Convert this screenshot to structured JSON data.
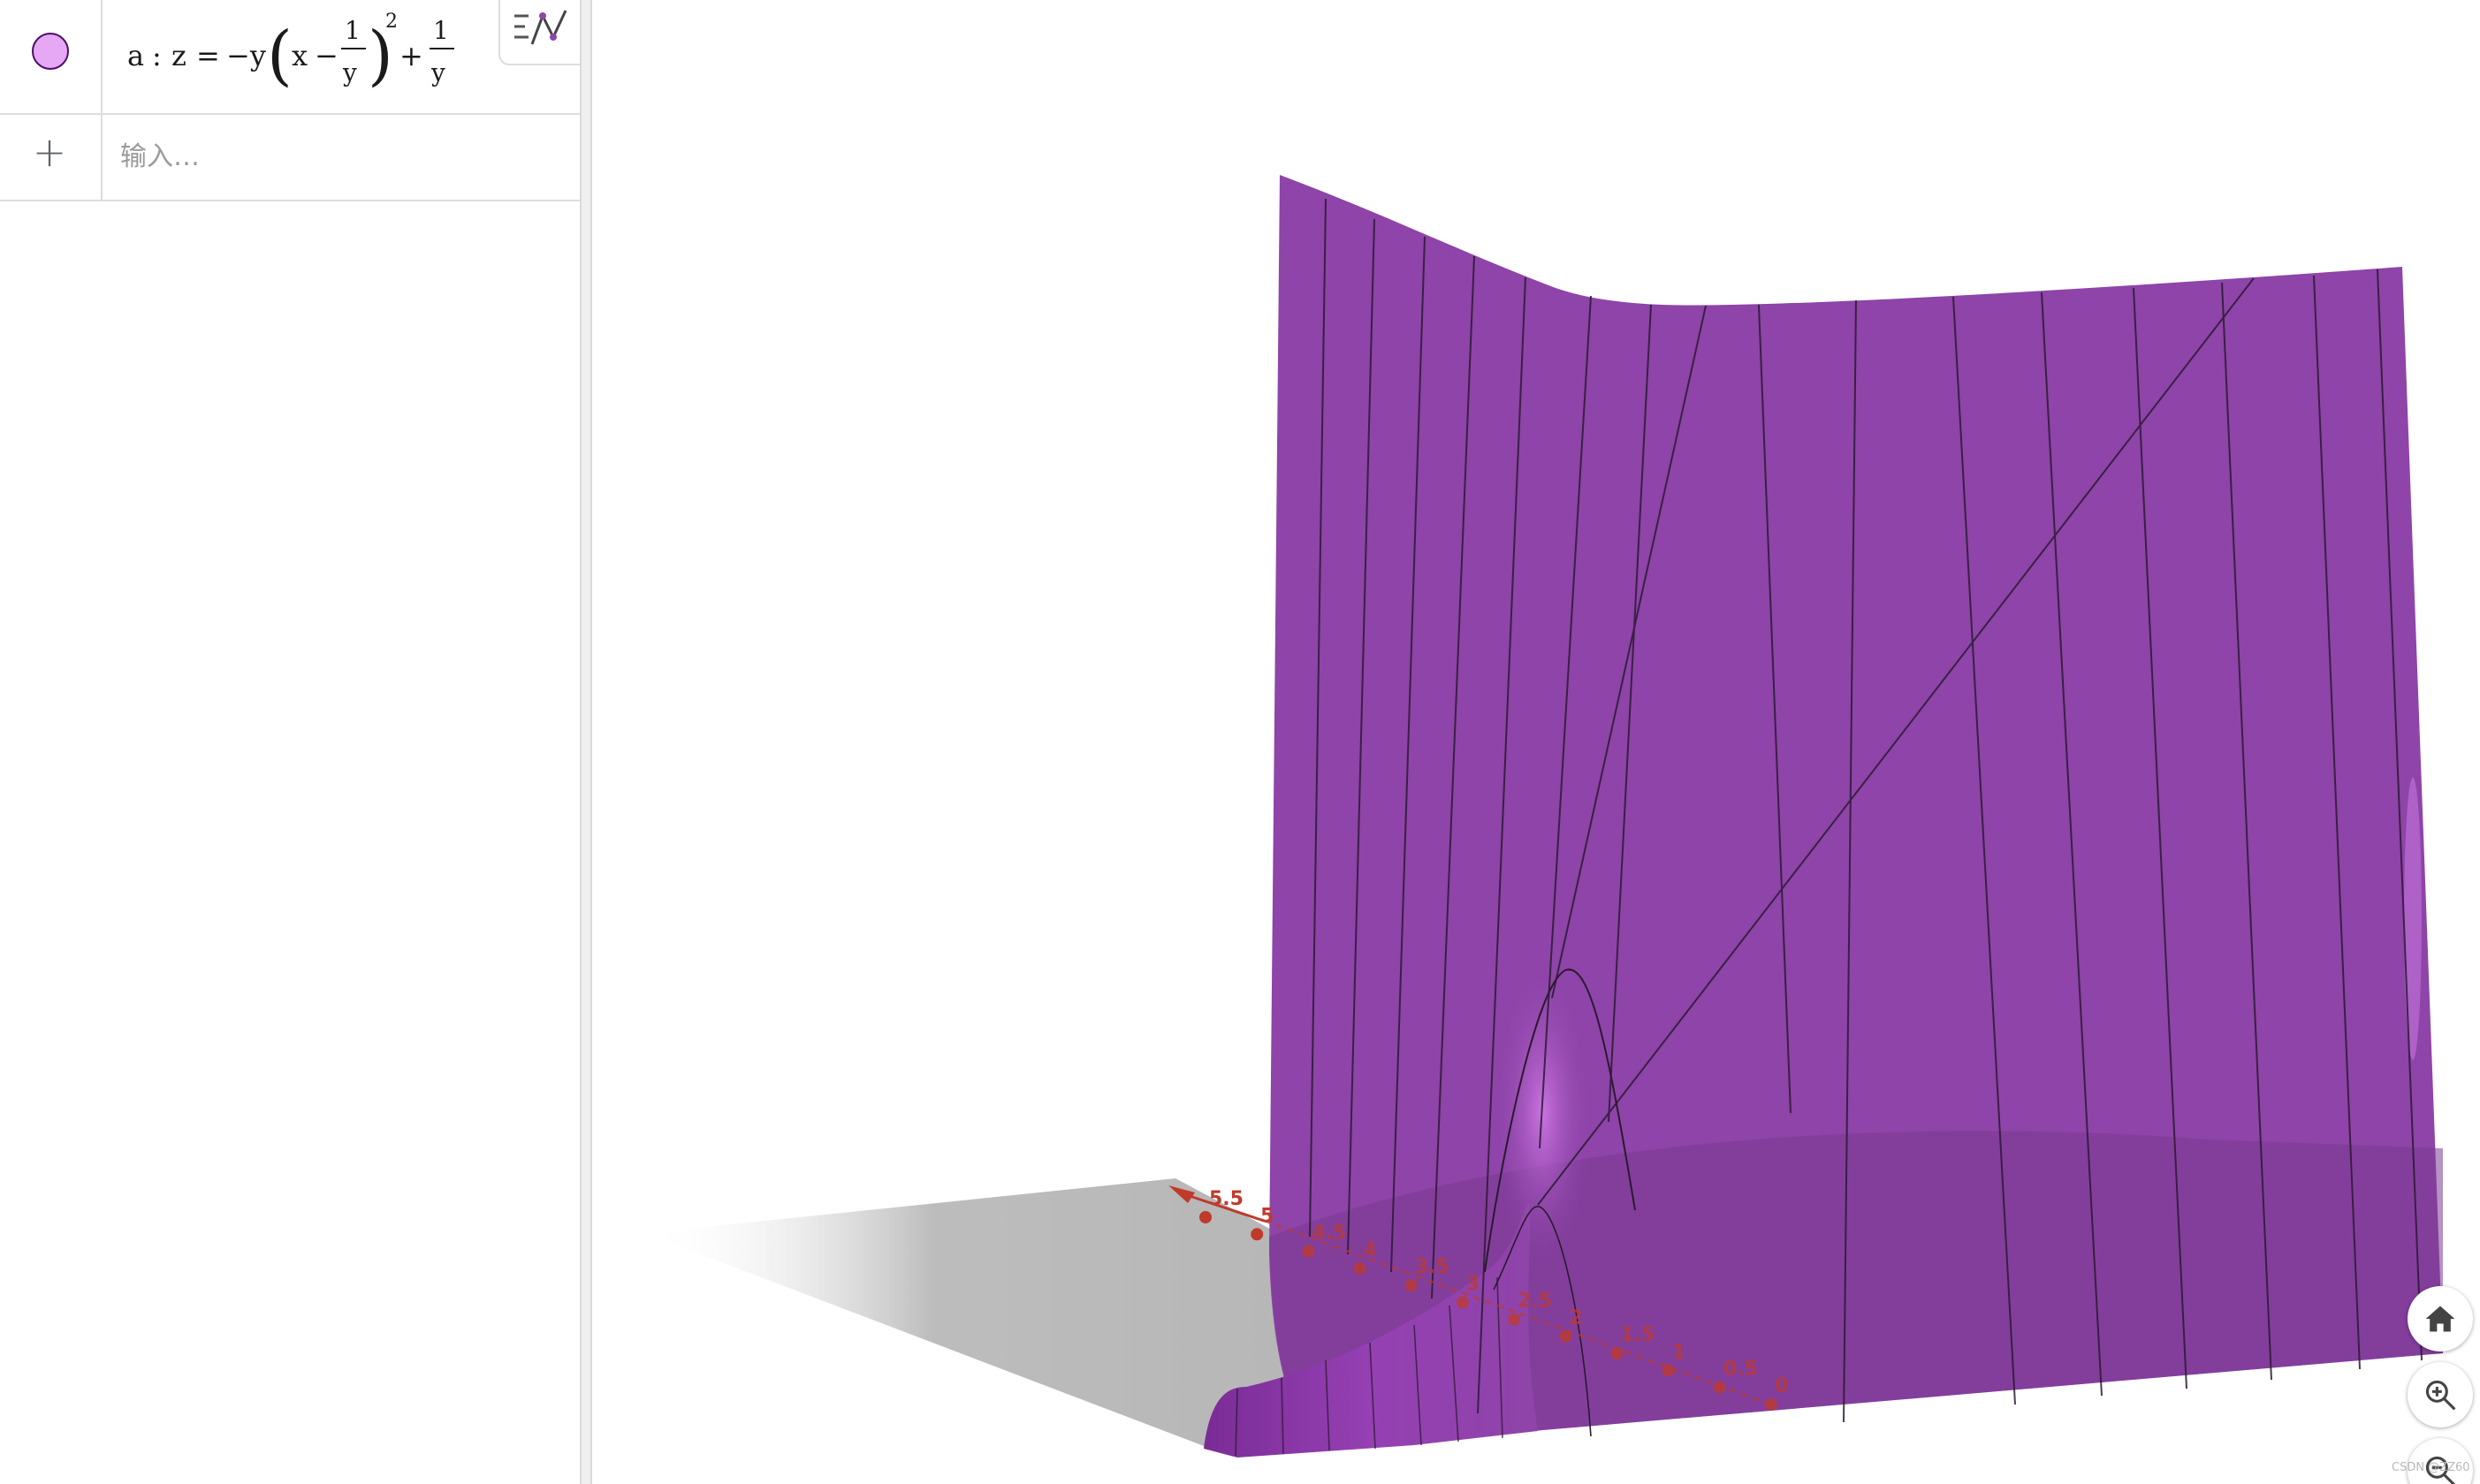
{
  "algebra_view": {
    "objects": [
      {
        "name": "a",
        "color": "#e6a7f5",
        "formula_parts": {
          "name": "a",
          "colon": ":",
          "lhs": "z",
          "equals": "=",
          "neg_y": "−y",
          "x": "x",
          "minus": "−",
          "frac1_num": "1",
          "frac1_den": "y",
          "exponent": "2",
          "plus": "+",
          "frac2_num": "1",
          "frac2_den": "y"
        }
      }
    ],
    "input_placeholder": "输入…",
    "add_symbol": "+"
  },
  "toolbar": {
    "buttons": [
      "axes-icon",
      "grid-icon",
      "home-icon",
      "view-cube-icon",
      "rotate-icon",
      "snap-magnet-icon",
      "settings-gear-icon",
      "more-vert-icon",
      "menu-perspective-icon"
    ],
    "active": "axes-icon"
  },
  "view3d": {
    "surface_color": "#8e44a8",
    "axis_color": "#c0392b",
    "axis_tick_labels": [
      "5.5",
      "5",
      "4.5",
      "4",
      "3.5",
      "3",
      "2.5",
      "2",
      "1.5",
      "1",
      "0.5",
      "0"
    ]
  },
  "zoom_controls": [
    "home-icon",
    "zoom-in-icon",
    "zoom-out-icon"
  ],
  "watermark": "CSDN @ZZ60"
}
